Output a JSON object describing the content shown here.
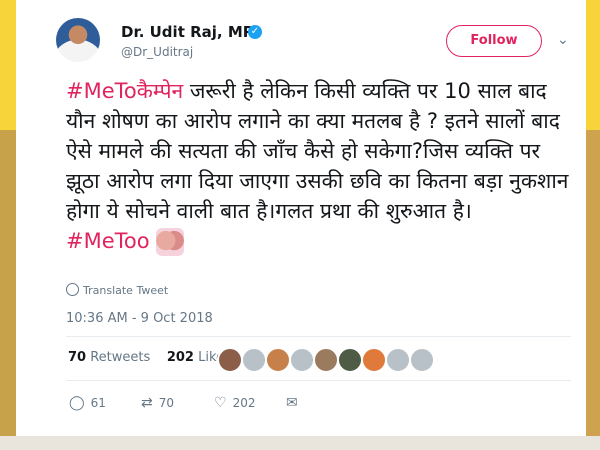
{
  "tweet": {
    "author_name": "Dr. Udit Raj, MP",
    "handle": "@Dr_Uditraj",
    "follow_label": "Follow",
    "text_hashtag_1": "#MeToकैम्पेन",
    "text_body": " जरूरी है लेकिन किसी व्यक्ति पर 10 साल बाद यौन शोषण का आरोप लगाने का क्या मतलब है ? इतने सालों बाद ऐसे मामले की सत्यता की जाँच कैसे हो सकेगा?जिस व्यक्ति पर झूठा आरोप लगा दिया जाएगा उसकी छवि का कितना बड़ा नुकशान होगा ये सोचने वाली बात है।गलत प्रथा की शुरुआत है।",
    "text_hashtag_2": "#MeToo",
    "translate_label": "Translate Tweet",
    "timestamp": "10:36 AM - 9 Oct 2018",
    "retweets_count": "70",
    "retweets_label": "Retweets",
    "likes_count": "202",
    "likes_label": "Likes",
    "reply_count": "61",
    "retweet_action_count": "70",
    "like_action_count": "202"
  },
  "icons": {
    "verified": "verified-badge-icon",
    "caret": "chevron-down-icon",
    "reply": "reply-icon",
    "retweet": "retweet-icon",
    "like": "heart-icon",
    "message": "message-icon",
    "translate": "globe-icon"
  },
  "colors": {
    "accent": "#e0245e",
    "verified": "#1da1f2",
    "muted": "#657786"
  }
}
